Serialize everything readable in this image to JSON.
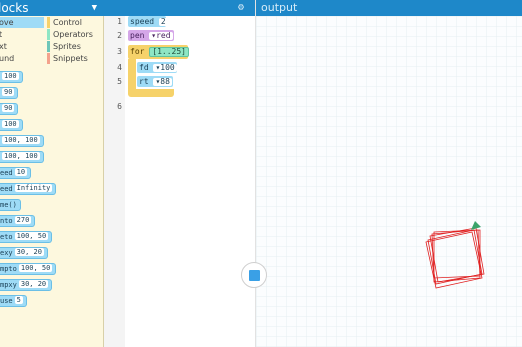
{
  "palette": {
    "header_title": "locks",
    "collapse_icon": "triangle-down-icon",
    "categories_left": [
      {
        "label": "ove",
        "color": "#9edbf6"
      },
      {
        "label": "t",
        "color": ""
      },
      {
        "label": "xt",
        "color": ""
      },
      {
        "label": "und",
        "color": ""
      }
    ],
    "categories_right": [
      {
        "label": "Control",
        "color": "#f6d26a"
      },
      {
        "label": "Operators",
        "color": "#8ee6c4"
      },
      {
        "label": "Sprites",
        "color": "#6ec6b8"
      },
      {
        "label": "Snippets",
        "color": "#f4a28c"
      }
    ],
    "blocks": [
      {
        "cmd": "",
        "arg": "100"
      },
      {
        "cmd": "",
        "arg": "90"
      },
      {
        "cmd": "",
        "arg": "90"
      },
      {
        "cmd": "",
        "arg": "100"
      },
      {
        "cmd": "",
        "arg": "100, 100"
      },
      {
        "cmd": "",
        "arg": "100, 100"
      },
      {
        "cmd": "eed",
        "arg": "10"
      },
      {
        "cmd": "eed",
        "arg": "Infinity"
      },
      {
        "cmd": "me()",
        "arg": ""
      },
      {
        "cmd": "nto",
        "arg": "270"
      },
      {
        "cmd": "eto",
        "arg": "100, 50"
      },
      {
        "cmd": "exy",
        "arg": "30, 20"
      },
      {
        "cmd": "mpto",
        "arg": "100, 50"
      },
      {
        "cmd": "mpxy",
        "arg": "30, 20"
      },
      {
        "cmd": "use",
        "arg": "5"
      }
    ]
  },
  "editor": {
    "settings_icon": "gear-icon",
    "line_numbers": [
      "1",
      "2",
      "3",
      "4",
      "5",
      "6"
    ],
    "line1": {
      "cmd": "speed",
      "arg": "2"
    },
    "line2": {
      "cmd": "pen",
      "arg": "red"
    },
    "line3": {
      "cmd": "for",
      "arg": "[1..25]"
    },
    "line4": {
      "cmd": "fd",
      "arg": "100"
    },
    "line5": {
      "cmd": "rt",
      "arg": "88"
    },
    "dropdown_glyph": "▾"
  },
  "output": {
    "title": "output",
    "grid_color": "#e6eef2",
    "square_color": "#e02020",
    "turtle_color": "#3aa36a"
  },
  "controls": {
    "stop_icon": "stop-square-icon"
  }
}
